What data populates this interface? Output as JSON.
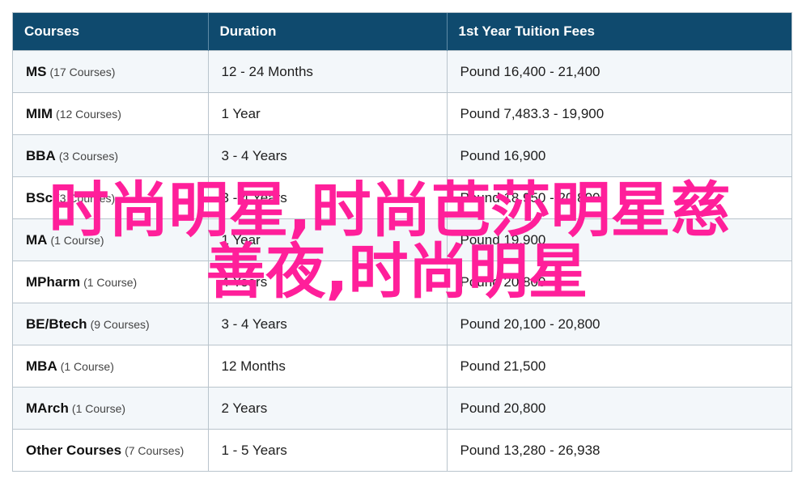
{
  "table": {
    "headers": [
      "Courses",
      "Duration",
      "1st Year Tuition Fees"
    ],
    "rows": [
      {
        "course": "MS",
        "count": "(17 Courses)",
        "duration": "12 - 24 Months",
        "fees": "Pound 16,400 - 21,400"
      },
      {
        "course": "MIM",
        "count": "(12 Courses)",
        "duration": "1 Year",
        "fees": "Pound 7,483.3 - 19,900"
      },
      {
        "course": "BBA",
        "count": "(3 Courses)",
        "duration": "3 - 4 Years",
        "fees": "Pound 16,900"
      },
      {
        "course": "BSc",
        "count": "(3 Courses)",
        "duration": "3 - 4 Years",
        "fees": "Pound 18,950 - 20,800"
      },
      {
        "course": "MA",
        "count": "(1 Course)",
        "duration": "1 Year",
        "fees": "Pound 19,900"
      },
      {
        "course": "MPharm",
        "count": "(1 Course)",
        "duration": "4 Years",
        "fees": "Pound 20,800"
      },
      {
        "course": "BE/Btech",
        "count": "(9 Courses)",
        "duration": "3 - 4 Years",
        "fees": "Pound 20,100 - 20,800"
      },
      {
        "course": "MBA",
        "count": "(1 Course)",
        "duration": "12 Months",
        "fees": "Pound 21,500"
      },
      {
        "course": "MArch",
        "count": "(1 Course)",
        "duration": "2 Years",
        "fees": "Pound 20,800"
      },
      {
        "course": "Other Courses",
        "count": "(7 Courses)",
        "duration": "1 - 5 Years",
        "fees": "Pound 13,280 - 26,938"
      }
    ]
  },
  "overlay": {
    "line1": "时尚明星,时尚芭莎明星慈",
    "line2": "善夜,时尚明星",
    "color": "#ff1f9a"
  },
  "colors": {
    "header_bg": "#0f4a6e",
    "stripe_bg": "#f3f7fa"
  }
}
